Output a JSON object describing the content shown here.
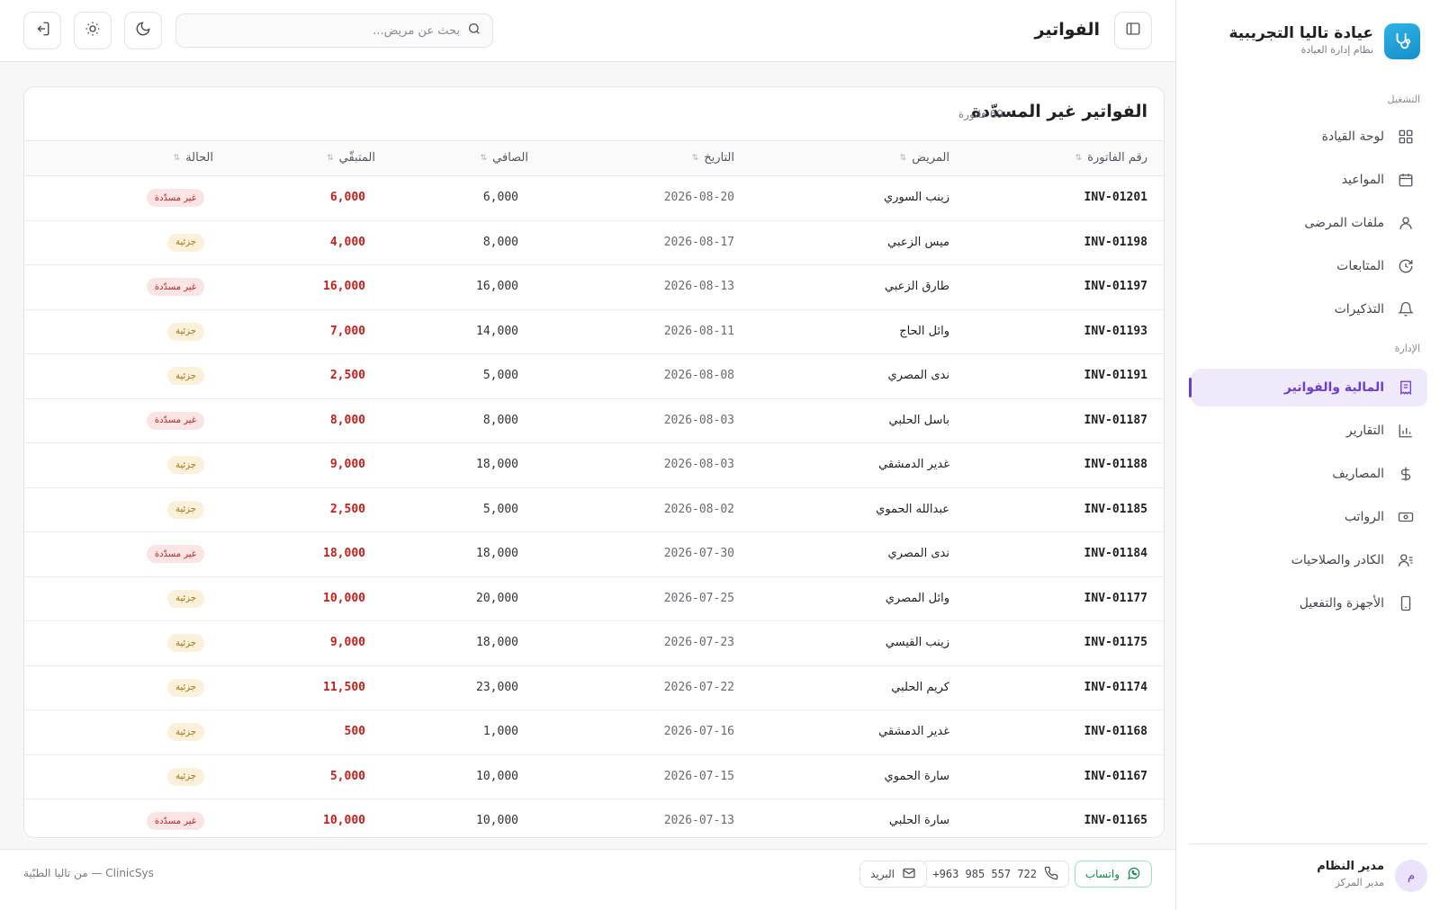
{
  "brand": {
    "title": "عيادة تاليا التجريبية",
    "subtitle": "نظام إدارة العيادة"
  },
  "sidebar": {
    "sections": [
      {
        "label": "التشغيل"
      },
      {
        "label": "الإدارة"
      }
    ],
    "items": [
      {
        "label": "لوحة القيادة",
        "icon": "dashboard-icon"
      },
      {
        "label": "المواعيد",
        "icon": "calendar-icon"
      },
      {
        "label": "ملفات المرضى",
        "icon": "user-icon"
      },
      {
        "label": "المتابعات",
        "icon": "refresh-icon"
      },
      {
        "label": "التذكيرات",
        "icon": "bell-icon"
      },
      {
        "label": "المالية والفواتير",
        "icon": "receipt-icon",
        "active": true
      },
      {
        "label": "التقارير",
        "icon": "chart-icon"
      },
      {
        "label": "المصاريف",
        "icon": "dollar-icon"
      },
      {
        "label": "الرواتب",
        "icon": "banknote-icon"
      },
      {
        "label": "الكادر والصلاحيات",
        "icon": "users-icon"
      },
      {
        "label": "الأجهزة والتفعيل",
        "icon": "device-icon"
      }
    ]
  },
  "user": {
    "initial": "م",
    "name": "مدير النظام",
    "role": "مدير المركز"
  },
  "header": {
    "title": "الفواتير",
    "search_placeholder": "بحث عن مريض..."
  },
  "card": {
    "title": "الفواتير غير المسدّدة",
    "count": "69 فاتورة",
    "columns": [
      "رقم الفاتورة",
      "المريض",
      "التاريخ",
      "الصافي",
      "المتبقّي",
      "الحالة"
    ],
    "rows": [
      {
        "inv": "INV-01201",
        "patient": "زينب السوري",
        "date": "2026-08-20",
        "net": "6,000",
        "remaining": "6,000",
        "status": "غير مسدّدة",
        "type": "unpaid"
      },
      {
        "inv": "INV-01198",
        "patient": "ميس الزعبي",
        "date": "2026-08-17",
        "net": "8,000",
        "remaining": "4,000",
        "status": "جزئية",
        "type": "partial"
      },
      {
        "inv": "INV-01197",
        "patient": "طارق الزعبي",
        "date": "2026-08-13",
        "net": "16,000",
        "remaining": "16,000",
        "status": "غير مسدّدة",
        "type": "unpaid"
      },
      {
        "inv": "INV-01193",
        "patient": "وائل الحاج",
        "date": "2026-08-11",
        "net": "14,000",
        "remaining": "7,000",
        "status": "جزئية",
        "type": "partial"
      },
      {
        "inv": "INV-01191",
        "patient": "ندى المصري",
        "date": "2026-08-08",
        "net": "5,000",
        "remaining": "2,500",
        "status": "جزئية",
        "type": "partial"
      },
      {
        "inv": "INV-01187",
        "patient": "باسل الحلبي",
        "date": "2026-08-03",
        "net": "8,000",
        "remaining": "8,000",
        "status": "غير مسدّدة",
        "type": "unpaid"
      },
      {
        "inv": "INV-01188",
        "patient": "غدير الدمشقي",
        "date": "2026-08-03",
        "net": "18,000",
        "remaining": "9,000",
        "status": "جزئية",
        "type": "partial"
      },
      {
        "inv": "INV-01185",
        "patient": "عبدالله الحموي",
        "date": "2026-08-02",
        "net": "5,000",
        "remaining": "2,500",
        "status": "جزئية",
        "type": "partial"
      },
      {
        "inv": "INV-01184",
        "patient": "ندى المصري",
        "date": "2026-07-30",
        "net": "18,000",
        "remaining": "18,000",
        "status": "غير مسدّدة",
        "type": "unpaid"
      },
      {
        "inv": "INV-01177",
        "patient": "وائل المصري",
        "date": "2026-07-25",
        "net": "20,000",
        "remaining": "10,000",
        "status": "جزئية",
        "type": "partial"
      },
      {
        "inv": "INV-01175",
        "patient": "زينب القيسي",
        "date": "2026-07-23",
        "net": "18,000",
        "remaining": "9,000",
        "status": "جزئية",
        "type": "partial"
      },
      {
        "inv": "INV-01174",
        "patient": "كريم الحلبي",
        "date": "2026-07-22",
        "net": "23,000",
        "remaining": "11,500",
        "status": "جزئية",
        "type": "partial"
      },
      {
        "inv": "INV-01168",
        "patient": "غدير الدمشقي",
        "date": "2026-07-16",
        "net": "1,000",
        "remaining": "500",
        "status": "جزئية",
        "type": "partial"
      },
      {
        "inv": "INV-01167",
        "patient": "سارة الحموي",
        "date": "2026-07-15",
        "net": "10,000",
        "remaining": "5,000",
        "status": "جزئية",
        "type": "partial"
      },
      {
        "inv": "INV-01165",
        "patient": "سارة الحلبي",
        "date": "2026-07-13",
        "net": "10,000",
        "remaining": "10,000",
        "status": "غير مسدّدة",
        "type": "unpaid"
      }
    ]
  },
  "footer": {
    "whatsapp": "واتساب",
    "phone": "+963 985 557 722",
    "email": "البريد",
    "copyright": "ClinicSys — من تاليا الطبّية"
  },
  "colors": {
    "accent": "#6a3fd0",
    "danger": "#c0211c",
    "brand": "#1f9ad6"
  }
}
